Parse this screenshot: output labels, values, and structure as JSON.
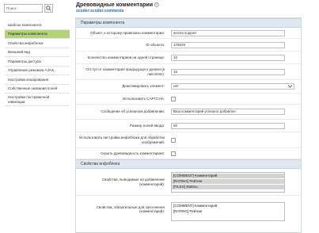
{
  "sidebar": {
    "search_placeholder": "Поиск",
    "items": [
      {
        "label": "Шаблон компонента",
        "selected": false
      },
      {
        "label": "Параметры компонента",
        "selected": true
      },
      {
        "label": "Свойства инфоблока",
        "selected": false
      },
      {
        "label": "Внешний вид",
        "selected": false
      },
      {
        "label": "Параметры доступа",
        "selected": false
      },
      {
        "label": "Управление режимом AJAX",
        "selected": false
      },
      {
        "label": "Настройки кеширования",
        "selected": false
      },
      {
        "label": "Собственные названия полей",
        "selected": false
      },
      {
        "label": "Настройки постраничной навигации",
        "selected": false
      }
    ]
  },
  "header": {
    "title": "Древовидные комментарии",
    "subtitle": "scoder:scoder.comments"
  },
  "sections": {
    "params": "Параметры компонента",
    "iblock": "Свойства инфоблока"
  },
  "fields": {
    "object_label": "Объект, к которому привязаны комментарии:",
    "object_value": "aroma:support",
    "id_label": "ID объекта:",
    "id_value": "176629",
    "per_page_label": "Количество комментариев на одной странице:",
    "per_page_value": "10",
    "indent_label": "Отступ от комментария предыдущего уровня (в пикселях):",
    "indent_value": "15",
    "deactivate_label": "Деактивировать элемент:",
    "deactivate_value": "нет",
    "captcha_label": "Использовать CAPTCHA:",
    "success_label": "Сообщение об успешном добавлении:",
    "success_value": "Ваш комментарий успешно добавлен.",
    "input_size_label": "Размер полей ввода:",
    "input_size_value": "50",
    "use_iblock_label": "Использовать настройки инфоблока для обработки изображений:",
    "hide_tree_label": "Скрыть древовидность комментариев:",
    "display_props_label": "Свойства, выводимые на добавление (комментарий):",
    "display_props_options": [
      "[COMMENT] Комментарий",
      "[RATING] Рейтинг",
      "[FILES] Файлы"
    ],
    "required_props_label": "Свойства, обязательные для заполнения (комментарий):",
    "required_props_options": [
      "[COMMENT] Комментарий",
      "[RATING] Рейтинг"
    ]
  },
  "icons": {
    "search": "search-icon",
    "help": "help-icon",
    "dropdown": "chevron-down-icon"
  },
  "colors": {
    "selected_nav": "#b5d27b",
    "section_bg": "#dfe8f0",
    "subtitle_link": "#2a6aad"
  }
}
